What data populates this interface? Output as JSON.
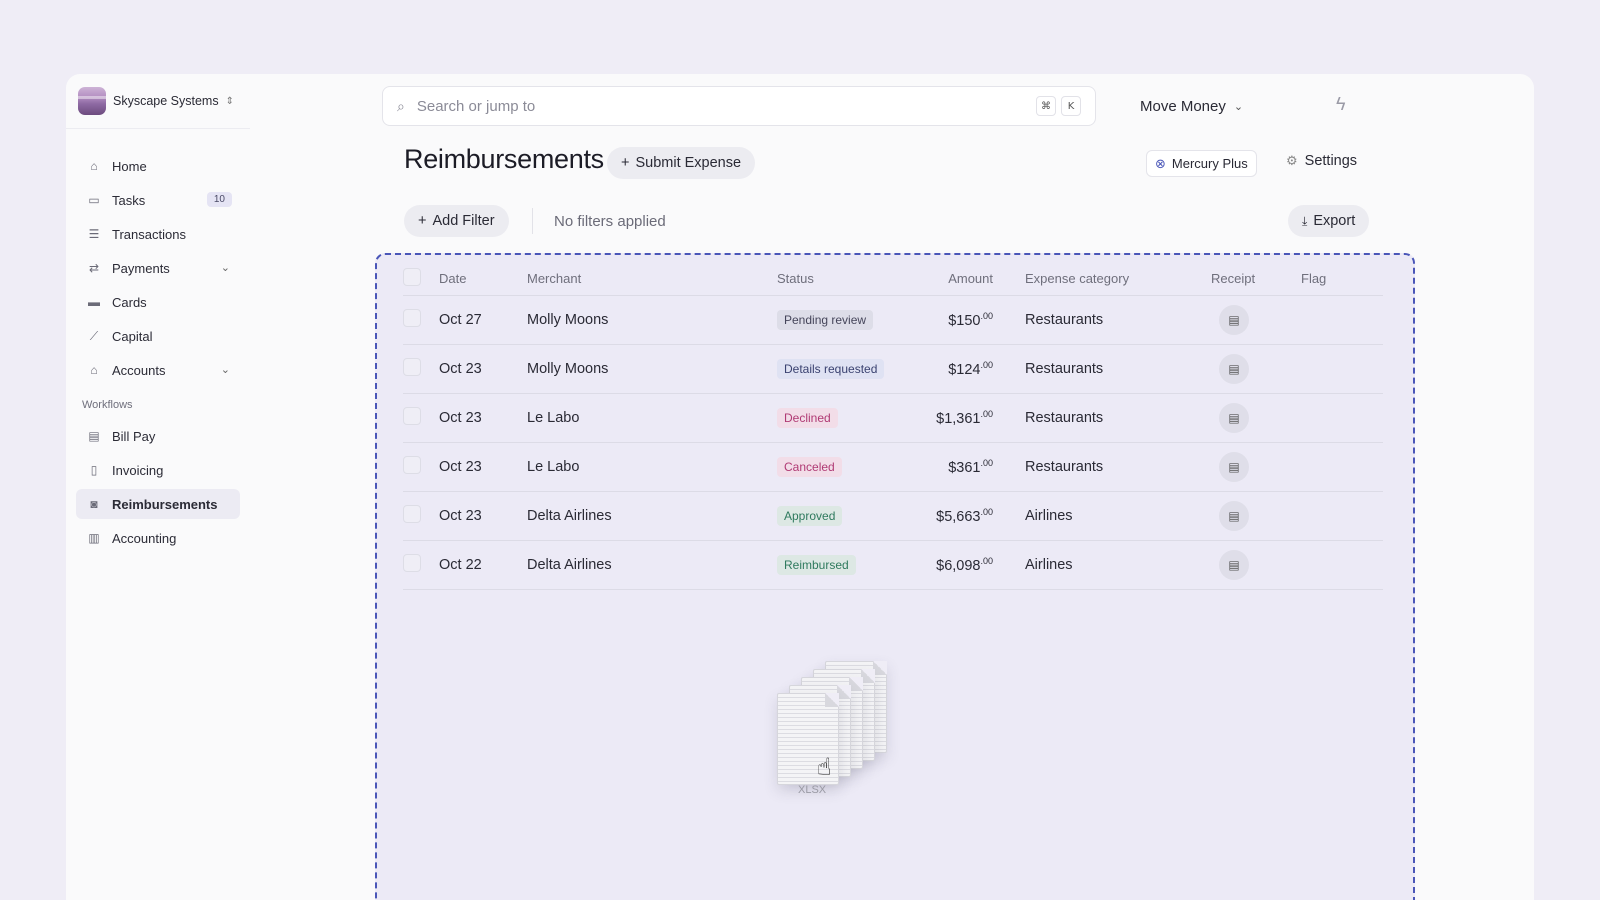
{
  "org": {
    "name": "Skyscape Systems"
  },
  "sidebar": {
    "items": [
      {
        "label": "Home",
        "icon": "home-icon",
        "glyph": "⌂"
      },
      {
        "label": "Tasks",
        "icon": "tasks-icon",
        "glyph": "▭",
        "badge": "10"
      },
      {
        "label": "Transactions",
        "icon": "list-icon",
        "glyph": "☰"
      },
      {
        "label": "Payments",
        "icon": "transfer-icon",
        "glyph": "⇄",
        "expandable": true
      },
      {
        "label": "Cards",
        "icon": "card-icon",
        "glyph": "▬"
      },
      {
        "label": "Capital",
        "icon": "chart-icon",
        "glyph": "⟋"
      },
      {
        "label": "Accounts",
        "icon": "bank-icon",
        "glyph": "⌂",
        "expandable": true
      }
    ],
    "section_label": "Workflows",
    "workflow_items": [
      {
        "label": "Bill Pay",
        "icon": "bill-icon",
        "glyph": "▤"
      },
      {
        "label": "Invoicing",
        "icon": "invoice-icon",
        "glyph": "▯"
      },
      {
        "label": "Reimbursements",
        "icon": "reimburse-icon",
        "glyph": "◙",
        "active": true
      },
      {
        "label": "Accounting",
        "icon": "book-icon",
        "glyph": "▥"
      }
    ]
  },
  "search": {
    "placeholder": "Search or jump to",
    "kbd1": "⌘",
    "kbd2": "K"
  },
  "topbar": {
    "move_money": "Move Money"
  },
  "page": {
    "title": "Reimbursements",
    "submit_label": "Submit Expense",
    "mercury_plus": "Mercury Plus",
    "settings": "Settings",
    "add_filter": "Add Filter",
    "no_filters": "No filters applied",
    "export": "Export"
  },
  "table": {
    "headers": [
      "Date",
      "Merchant",
      "Status",
      "Amount",
      "Expense category",
      "Receipt",
      "Flag"
    ],
    "rows": [
      {
        "date": "Oct 27",
        "merchant": "Molly Moons",
        "status": "Pending review",
        "status_class": "st-pending",
        "amount": "$150",
        "cents": ".00",
        "category": "Restaurants"
      },
      {
        "date": "Oct 23",
        "merchant": "Molly Moons",
        "status": "Details requested",
        "status_class": "st-details",
        "amount": "$124",
        "cents": ".00",
        "category": "Restaurants"
      },
      {
        "date": "Oct 23",
        "merchant": "Le Labo",
        "status": "Declined",
        "status_class": "st-declined",
        "amount": "$1,361",
        "cents": ".00",
        "category": "Restaurants"
      },
      {
        "date": "Oct 23",
        "merchant": "Le Labo",
        "status": "Canceled",
        "status_class": "st-canceled",
        "amount": "$361",
        "cents": ".00",
        "category": "Restaurants"
      },
      {
        "date": "Oct 23",
        "merchant": "Delta Airlines",
        "status": "Approved",
        "status_class": "st-approved",
        "amount": "$5,663",
        "cents": ".00",
        "category": "Airlines"
      },
      {
        "date": "Oct 22",
        "merchant": "Delta Airlines",
        "status": "Reimbursed",
        "status_class": "st-reimbursed",
        "amount": "$6,098",
        "cents": ".00",
        "category": "Airlines"
      }
    ]
  },
  "drag": {
    "file_label": "XLSX"
  },
  "colors": {
    "accent": "#4a56b8",
    "background": "#efedf6"
  }
}
